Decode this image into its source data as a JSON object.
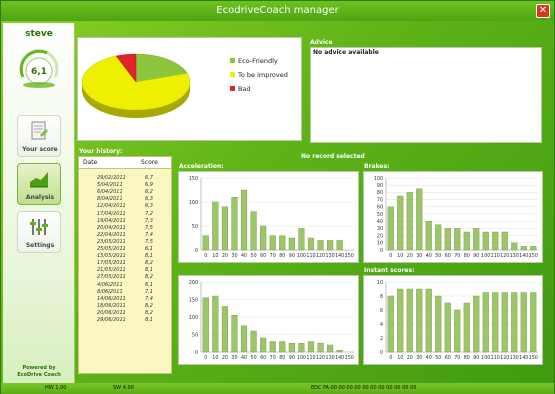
{
  "window": {
    "title": "EcodriveCoach manager",
    "close_glyph": "✕"
  },
  "sidebar": {
    "username": "steve",
    "score": "6,1",
    "nav": [
      {
        "label": "Your score",
        "icon": "score-sheet-icon"
      },
      {
        "label": "Analysis",
        "icon": "analysis-chart-icon",
        "active": true
      },
      {
        "label": "Settings",
        "icon": "settings-sliders-icon"
      }
    ],
    "powered_line1": "Powered by",
    "powered_line2": "EcoDrive Coach"
  },
  "pie": {
    "slices": [
      {
        "label": "Eco-Friendly",
        "value": 20,
        "color": "#8cc63f"
      },
      {
        "label": "To be improved",
        "value": 74,
        "color": "#eef000"
      },
      {
        "label": "Bad",
        "value": 6,
        "color": "#e0222a"
      }
    ]
  },
  "advice": {
    "label": "Advice",
    "text": "No advice available"
  },
  "history": {
    "label": "Your history:",
    "col_date": "Date",
    "col_score": "Score",
    "rows": [
      [
        "29/02/2011",
        "6,7"
      ],
      [
        "5/04/2011",
        "6,9"
      ],
      [
        "6/04/2011",
        "6,2"
      ],
      [
        "8/04/2011",
        "6,3"
      ],
      [
        "12/04/2011",
        "6,3"
      ],
      [
        "17/04/2011",
        "7,2"
      ],
      [
        "19/04/2011",
        "7,3"
      ],
      [
        "20/04/2011",
        "7,5"
      ],
      [
        "22/04/2011",
        "7,4"
      ],
      [
        "23/05/2011",
        "7,5"
      ],
      [
        "25/05/2011",
        "6,1"
      ],
      [
        "15/05/2011",
        "8,1"
      ],
      [
        "17/05/2011",
        "8,2"
      ],
      [
        "21/05/2011",
        "8,1"
      ],
      [
        "27/05/2011",
        "8,2"
      ],
      [
        "4/06/2011",
        "8,1"
      ],
      [
        "8/06/2011",
        "7,1"
      ],
      [
        "14/06/2011",
        "7,4"
      ],
      [
        "18/06/2011",
        "8,2"
      ],
      [
        "20/06/2011",
        "8,2"
      ],
      [
        "29/06/2011",
        "8,1"
      ]
    ]
  },
  "no_record": "No record selected",
  "chart_data": [
    {
      "type": "bar",
      "title": "Acceleration:",
      "categories": [
        "0",
        "10",
        "20",
        "30",
        "40",
        "50",
        "60",
        "70",
        "80",
        "90",
        "100",
        "110",
        "120",
        "130",
        "140",
        "150"
      ],
      "values": [
        30,
        100,
        90,
        110,
        125,
        80,
        50,
        30,
        30,
        25,
        45,
        25,
        20,
        20,
        20,
        0
      ],
      "ylim": [
        0,
        150
      ],
      "yticks": [
        0,
        50,
        100,
        150
      ]
    },
    {
      "type": "bar",
      "title": "Brakes:",
      "categories": [
        "0",
        "10",
        "20",
        "30",
        "40",
        "50",
        "60",
        "70",
        "80",
        "90",
        "100",
        "110",
        "120",
        "130",
        "140",
        "150"
      ],
      "values": [
        60,
        75,
        80,
        85,
        40,
        35,
        30,
        30,
        25,
        30,
        25,
        25,
        25,
        10,
        5,
        5
      ],
      "ylim": [
        0,
        100
      ],
      "yticks": [
        0,
        10,
        20,
        30,
        40,
        50,
        60,
        70,
        80,
        90,
        100
      ]
    },
    {
      "type": "bar",
      "title": "",
      "categories": [
        "0",
        "10",
        "20",
        "30",
        "40",
        "50",
        "60",
        "70",
        "80",
        "90",
        "100",
        "110",
        "120",
        "130",
        "140",
        "150"
      ],
      "values": [
        155,
        160,
        130,
        105,
        75,
        60,
        40,
        30,
        30,
        25,
        25,
        30,
        25,
        20,
        5,
        0
      ],
      "ylim": [
        0,
        200
      ],
      "yticks": [
        0,
        50,
        100,
        150,
        200
      ]
    },
    {
      "type": "bar",
      "title": "Instant scores:",
      "categories": [
        "0",
        "10",
        "20",
        "30",
        "40",
        "50",
        "60",
        "70",
        "80",
        "90",
        "100",
        "110",
        "120",
        "130",
        "140",
        "150"
      ],
      "values": [
        8,
        9,
        9,
        9,
        9,
        8,
        7,
        6,
        7,
        8,
        8.5,
        8.5,
        8.5,
        8.5,
        8.5,
        8.5
      ],
      "ylim": [
        0,
        10
      ],
      "yticks": [
        0,
        2,
        4,
        6,
        8,
        10
      ]
    }
  ],
  "statusbar": {
    "hw": "HW 1.00",
    "sw": "SW 4.00",
    "edc": "EDC FA 00 00 00 00 00 00 00 00 00 00 00"
  }
}
